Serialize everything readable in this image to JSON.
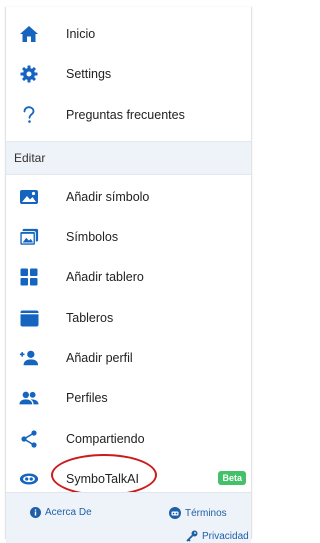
{
  "colors": {
    "icon": "#1565c0",
    "section_bg": "#eef3f9",
    "beta_bg": "#43c06a",
    "highlight": "#cc1b1b",
    "link": "#1f5fa8"
  },
  "menu": {
    "items": [
      {
        "label": "Inicio",
        "icon": "home-icon"
      },
      {
        "label": "Settings",
        "icon": "gear-icon"
      },
      {
        "label": "Preguntas frecuentes",
        "icon": "question-icon"
      }
    ]
  },
  "edit_section": {
    "header": "Editar",
    "items": [
      {
        "label": "Añadir símbolo",
        "icon": "add-image-icon"
      },
      {
        "label": "Símbolos",
        "icon": "images-icon"
      },
      {
        "label": "Añadir tablero",
        "icon": "grid-icon"
      },
      {
        "label": "Tableros",
        "icon": "board-icon"
      },
      {
        "label": "Añadir perfil",
        "icon": "add-person-icon"
      },
      {
        "label": "Perfiles",
        "icon": "people-icon"
      },
      {
        "label": "Compartiendo",
        "icon": "share-icon"
      },
      {
        "label": "SymboTalkAI",
        "icon": "ai-icon",
        "badge": "Beta"
      }
    ]
  },
  "footer": {
    "about": "Acerca De",
    "terms": "Términos",
    "privacy": "Privacidad"
  }
}
